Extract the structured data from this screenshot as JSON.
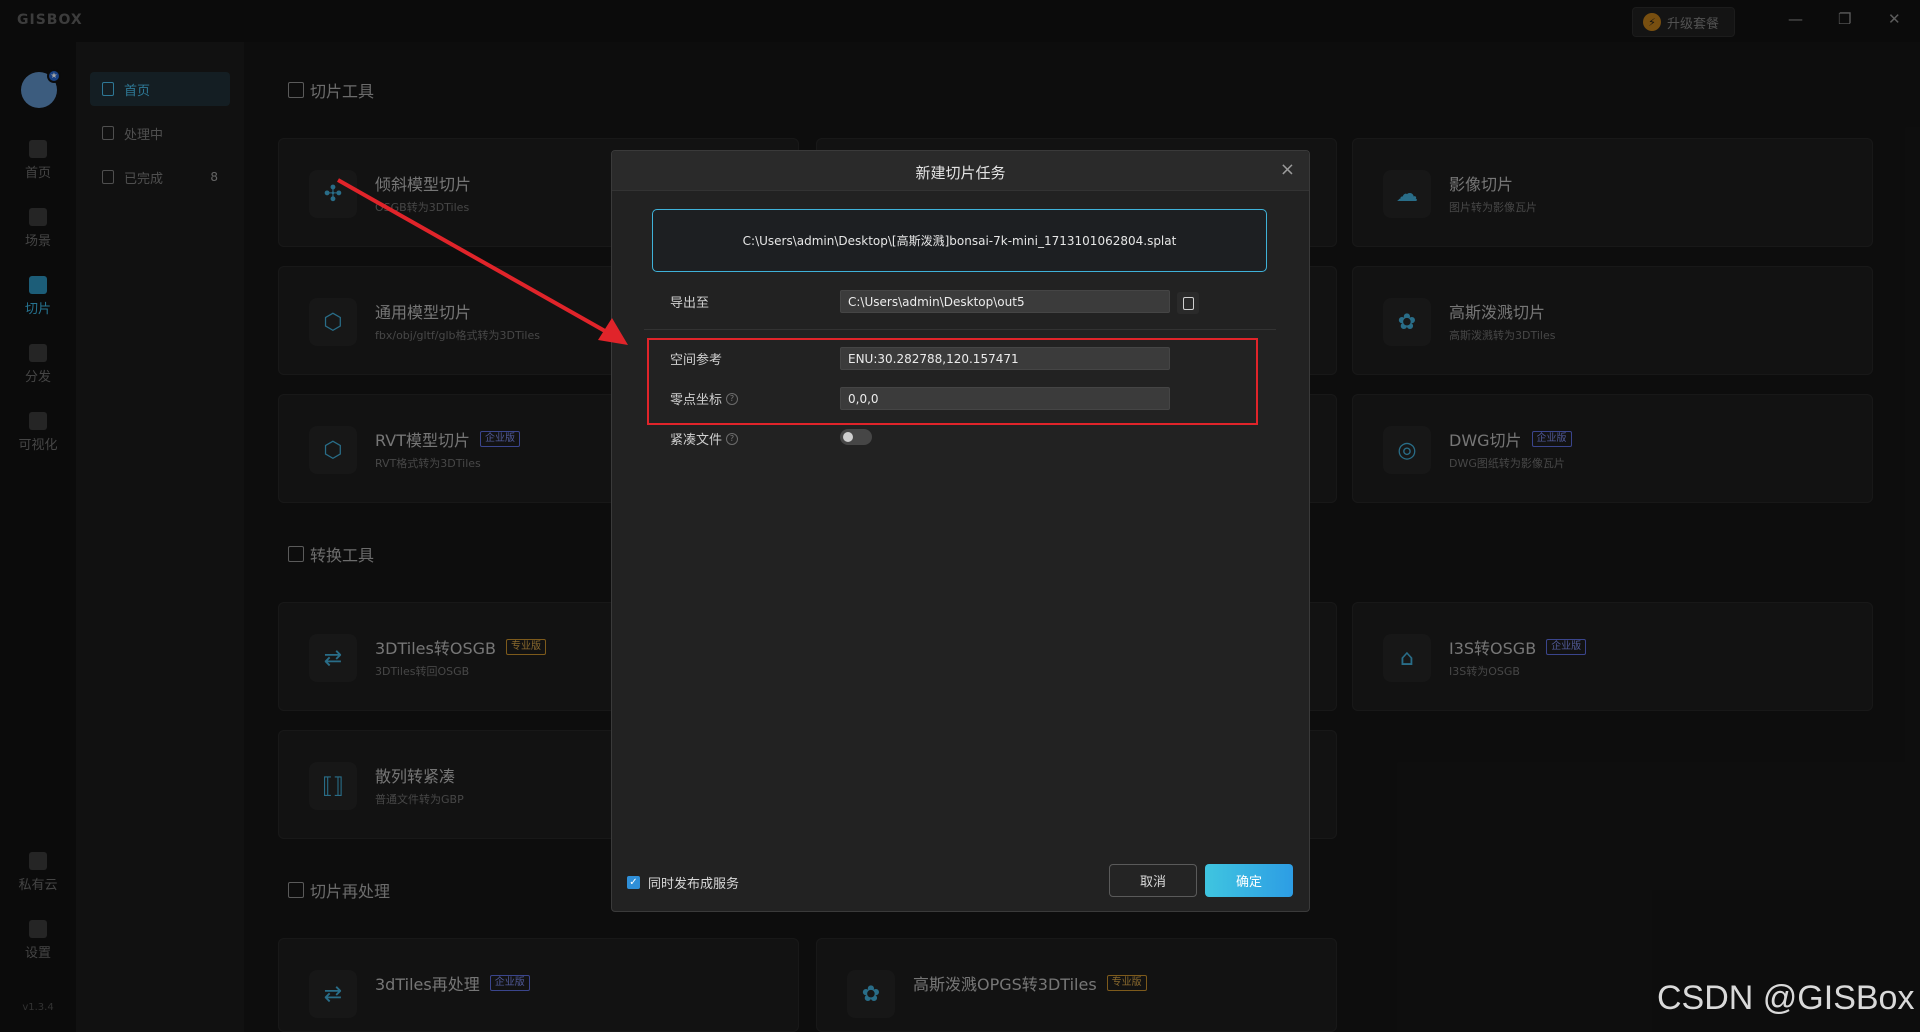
{
  "app": {
    "logo": "GISBOX",
    "upgrade_label": "升级套餐",
    "window_controls": [
      "—",
      "❐",
      "✕"
    ],
    "version": "v1.3.4"
  },
  "leftnav": [
    {
      "label": "首页",
      "icon": "home-icon"
    },
    {
      "label": "场景",
      "icon": "cube-icon"
    },
    {
      "label": "切片",
      "icon": "slice-icon",
      "active": true
    },
    {
      "label": "分发",
      "icon": "share-icon"
    },
    {
      "label": "可视化",
      "icon": "eye-icon"
    },
    {
      "label": "私有云",
      "icon": "lock-cloud-icon"
    },
    {
      "label": "设置",
      "icon": "gear-icon"
    }
  ],
  "subnav": [
    {
      "label": "首页",
      "active": true
    },
    {
      "label": "处理中"
    },
    {
      "label": "已完成",
      "count": "8"
    }
  ],
  "sections": {
    "slice_tools": "切片工具",
    "convert_tools": "转换工具",
    "reprocess": "切片再处理"
  },
  "cards": {
    "oblique": {
      "title": "倾斜模型切片",
      "sub": "OSGB转为3DTiles"
    },
    "general": {
      "title": "通用模型切片",
      "sub": "fbx/obj/gltf/glb格式转为3DTiles"
    },
    "rvt": {
      "title": "RVT模型切片",
      "sub": "RVT格式转为3DTiles",
      "tag": "企业版"
    },
    "image": {
      "title": "影像切片",
      "sub": "图片转为影像瓦片"
    },
    "gauss": {
      "title": "高斯泼溅切片",
      "sub": "高斯泼溅转为3DTiles"
    },
    "dwg": {
      "title": "DWG切片",
      "sub": "DWG图纸转为影像瓦片",
      "tag": "企业版"
    },
    "tiles2osgb": {
      "title": "3DTiles转OSGB",
      "sub": "3DTiles转回OSGB",
      "tag": "专业版"
    },
    "i3s2osgb": {
      "title": "I3S转OSGB",
      "sub": "I3S转为OSGB",
      "tag": "企业版"
    },
    "scatter": {
      "title": "散列转紧凑",
      "sub": "普通文件转为GBP"
    },
    "tiles_reprocess": {
      "title": "3dTiles再处理",
      "tag": "企业版"
    },
    "gauss_opgs": {
      "title": "高斯泼溅OPGS转3DTiles",
      "tag": "专业版"
    }
  },
  "dialog": {
    "title": "新建切片任务",
    "file_path": "C:\\Users\\admin\\Desktop\\[高斯泼溅]bonsai-7k-mini_1713101062804.splat",
    "export_label": "导出至",
    "export_value": "C:\\Users\\admin\\Desktop\\out5",
    "spatial_label": "空间参考",
    "spatial_value": "ENU:30.282788,120.157471",
    "origin_label": "零点坐标",
    "origin_value": "0,0,0",
    "compact_label": "紧凑文件",
    "compact_on": false,
    "publish_label": "同时发布成服务",
    "publish_checked": true,
    "cancel_label": "取消",
    "ok_label": "确定"
  },
  "watermark": "CSDN @GISBox",
  "colors": {
    "accent": "#3fb2d9",
    "highlight_box": "#e0242a",
    "enterprise_tag": "#5a6bd8",
    "pro_tag": "#c08a2a"
  }
}
